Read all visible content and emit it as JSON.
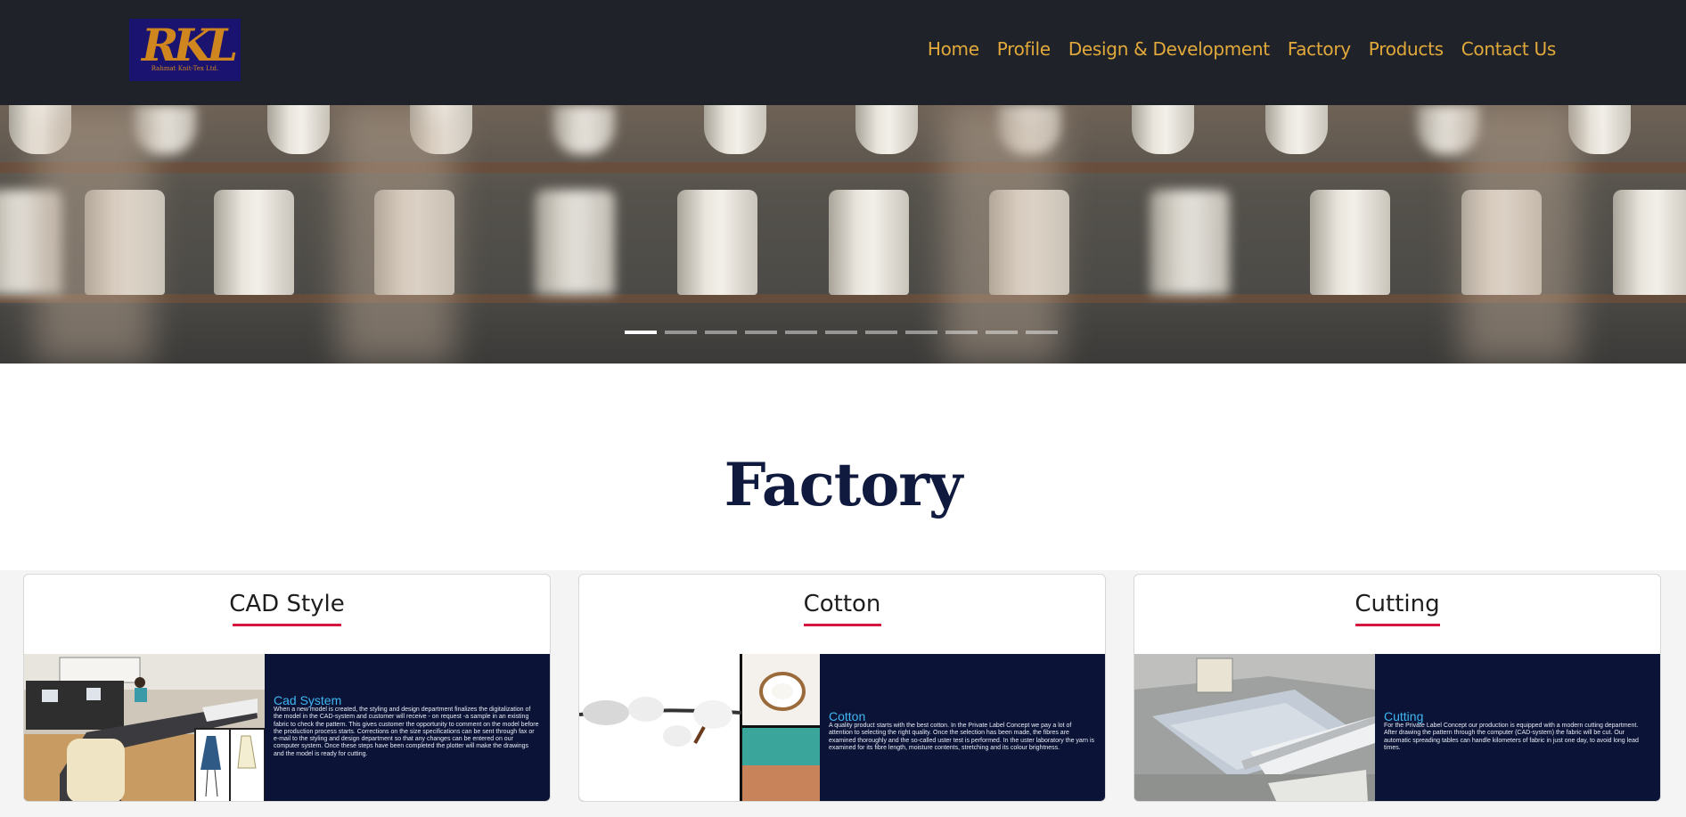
{
  "header": {
    "logo": {
      "mark": "RKL",
      "tagline": "Rahmat Knit-Tex Ltd."
    },
    "nav": [
      "Home",
      "Profile",
      "Design & Development",
      "Factory",
      "Products",
      "Contact Us"
    ],
    "colors": {
      "background": "#1f2228",
      "nav_text": "#e2a93b"
    }
  },
  "hero": {
    "slide_count": 11,
    "active_slide": 1
  },
  "section": {
    "title": "Factory"
  },
  "cards": [
    {
      "title": "CAD Style",
      "panel_title": "Cad System",
      "panel_text": "When a new model is created, the styling and design department finalizes the digitalization of the model in the CAD-system and customer will receive - on request -a sample in an existing fabric to check the pattern. This gives customer the opportunity to comment on the model before the production process starts. Corrections on the size specifications can be sent through fax or e-mail to the styling and design department so that any changes can be entered on our computer system. Once these steps have been completed the plotter will make the drawings and the model is ready for cutting."
    },
    {
      "title": "Cotton",
      "panel_title": "Cotton",
      "panel_text": "A quality product starts with the best cotton. In the Private Label Concept we pay a lot of attention to selecting the right quality. Once the selection has been made, the fibres are examined thoroughly and the so-called uster test is performed. In the uster laboratory the yarn is examined for its fibre length, moisture contents, stretching and its colour brightness."
    },
    {
      "title": "Cutting",
      "panel_title": "Cutting",
      "panel_text": "For the Private Label Concept our production is equipped with a modern cutting department. After drawing the pattern through the computer (CAD-system) the fabric will be cut. Our automatic spreading tables can handle kilometers of fabric in just one day, to avoid long lead times."
    }
  ],
  "accent_colors": {
    "underline": "#d4183d",
    "panel_bg": "#0b1437",
    "panel_title": "#3fb6f0",
    "section_title": "#0f1a3e"
  }
}
